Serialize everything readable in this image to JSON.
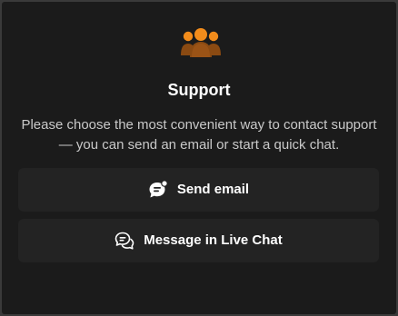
{
  "support": {
    "logo_icon": "support-team-icon",
    "title": "Support",
    "description": "Please choose the most convenient way to contact support — you can send an email or start a quick chat.",
    "email_button": {
      "label": "Send email",
      "icon": "email-chat-icon"
    },
    "chat_button": {
      "label": "Message in Live Chat",
      "icon": "chat-bubbles-icon"
    },
    "colors": {
      "accent": "#f28c1b",
      "accent_dark": "#8a4a12",
      "panel_bg": "#1b1b1b",
      "button_bg": "#232323",
      "text": "#ffffff",
      "muted_text": "#c9c9c9"
    }
  }
}
